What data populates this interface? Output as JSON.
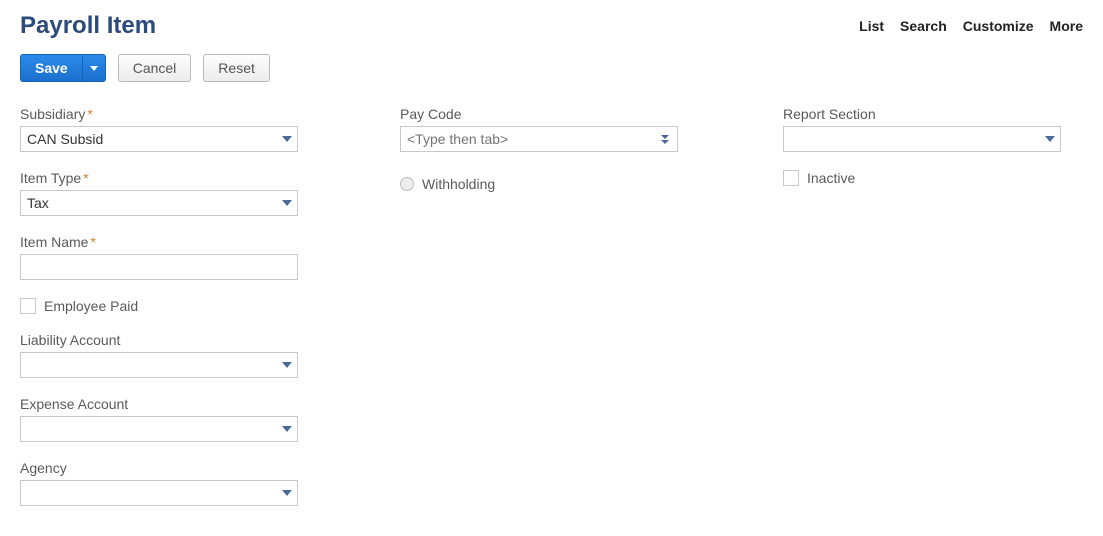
{
  "header": {
    "title": "Payroll Item",
    "links": {
      "list": "List",
      "search": "Search",
      "customize": "Customize",
      "more": "More"
    }
  },
  "toolbar": {
    "save_label": "Save",
    "cancel_label": "Cancel",
    "reset_label": "Reset"
  },
  "col1": {
    "subsidiary": {
      "label": "Subsidiary",
      "required": true,
      "value": "CAN Subsid"
    },
    "item_type": {
      "label": "Item Type",
      "required": true,
      "value": "Tax"
    },
    "item_name": {
      "label": "Item Name",
      "required": true,
      "value": ""
    },
    "employee_paid": {
      "label": "Employee Paid",
      "checked": false
    },
    "liability_account": {
      "label": "Liability Account",
      "value": ""
    },
    "expense_account": {
      "label": "Expense Account",
      "value": ""
    },
    "agency": {
      "label": "Agency",
      "value": ""
    }
  },
  "col2": {
    "pay_code": {
      "label": "Pay Code",
      "placeholder": "<Type then tab>",
      "value": ""
    },
    "withholding": {
      "label": "Withholding"
    }
  },
  "col3": {
    "report_section": {
      "label": "Report Section",
      "value": ""
    },
    "inactive": {
      "label": "Inactive",
      "checked": false
    }
  }
}
